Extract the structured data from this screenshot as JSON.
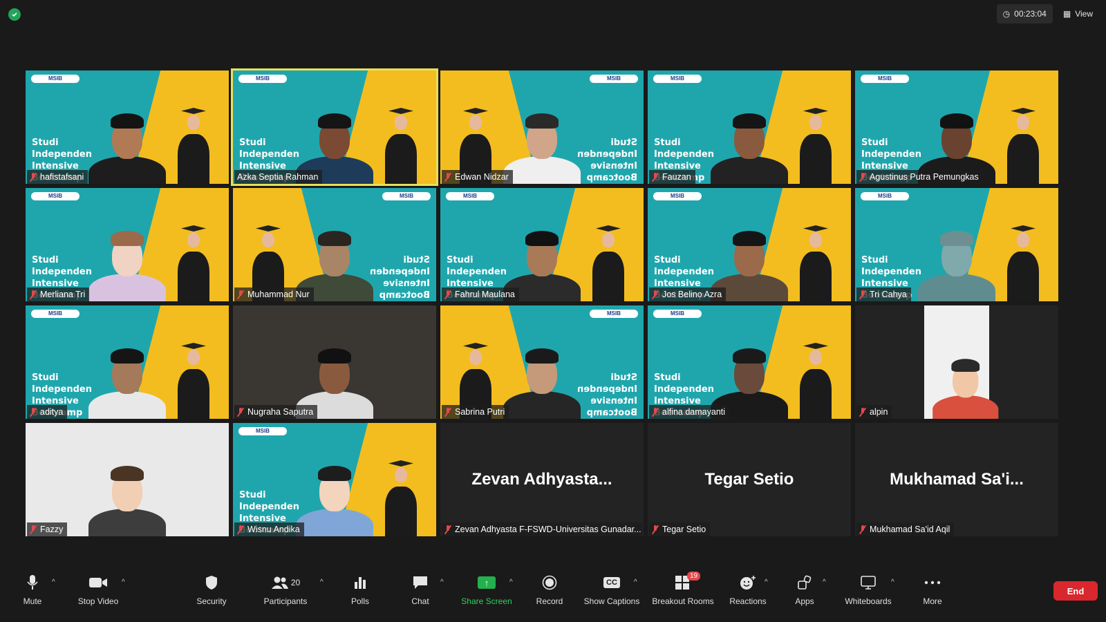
{
  "top": {
    "timer": "00:23:04",
    "view_label": "View"
  },
  "background_text": "Studi\nIndependen\nIntensive\nBootcamp",
  "logo_text": "MSIB",
  "tiles": [
    {
      "name": "hafistafsani"
    },
    {
      "name": "Azka Septia Rahman"
    },
    {
      "name": "Edwan Nidzar"
    },
    {
      "name": "Fauzan"
    },
    {
      "name": "Agustinus Putra Pemungkas"
    },
    {
      "name": "Merliana Tri"
    },
    {
      "name": "Muhammad Nur"
    },
    {
      "name": "Fahrul Maulana"
    },
    {
      "name": "Jos Belino Azra"
    },
    {
      "name": "Tri Cahya"
    },
    {
      "name": "aditya"
    },
    {
      "name": "Nugraha Saputra"
    },
    {
      "name": "Sabrina Putri"
    },
    {
      "name": "alfina damayanti"
    },
    {
      "name": "alpin"
    },
    {
      "name": "Fazzy"
    },
    {
      "name": "Wisnu Andika"
    },
    {
      "name": "Zevan Adhyasta F-FSWD-Universitas Gunadar...",
      "display": "Zevan  Adhyasta..."
    },
    {
      "name": "Tegar Setio",
      "display": "Tegar Setio"
    },
    {
      "name": "Mukhamad Sa'id Aqil",
      "display": "Mukhamad  Sa'i..."
    }
  ],
  "toolbar": {
    "mute": "Mute",
    "stop_video": "Stop Video",
    "security": "Security",
    "participants": "Participants",
    "participants_count": "20",
    "polls": "Polls",
    "chat": "Chat",
    "share_screen": "Share Screen",
    "record": "Record",
    "show_captions": "Show Captions",
    "cc_icon_text": "CC",
    "breakout_rooms": "Breakout Rooms",
    "breakout_badge": "19",
    "reactions": "Reactions",
    "apps": "Apps",
    "whiteboards": "Whiteboards",
    "more": "More",
    "end": "End"
  },
  "colors": {
    "accent_green": "#2fd35c",
    "end_red": "#d9272e",
    "active_border": "#e8e05a",
    "teal_bg": "#1fa6ad",
    "yellow_bg": "#f3bd1f"
  }
}
